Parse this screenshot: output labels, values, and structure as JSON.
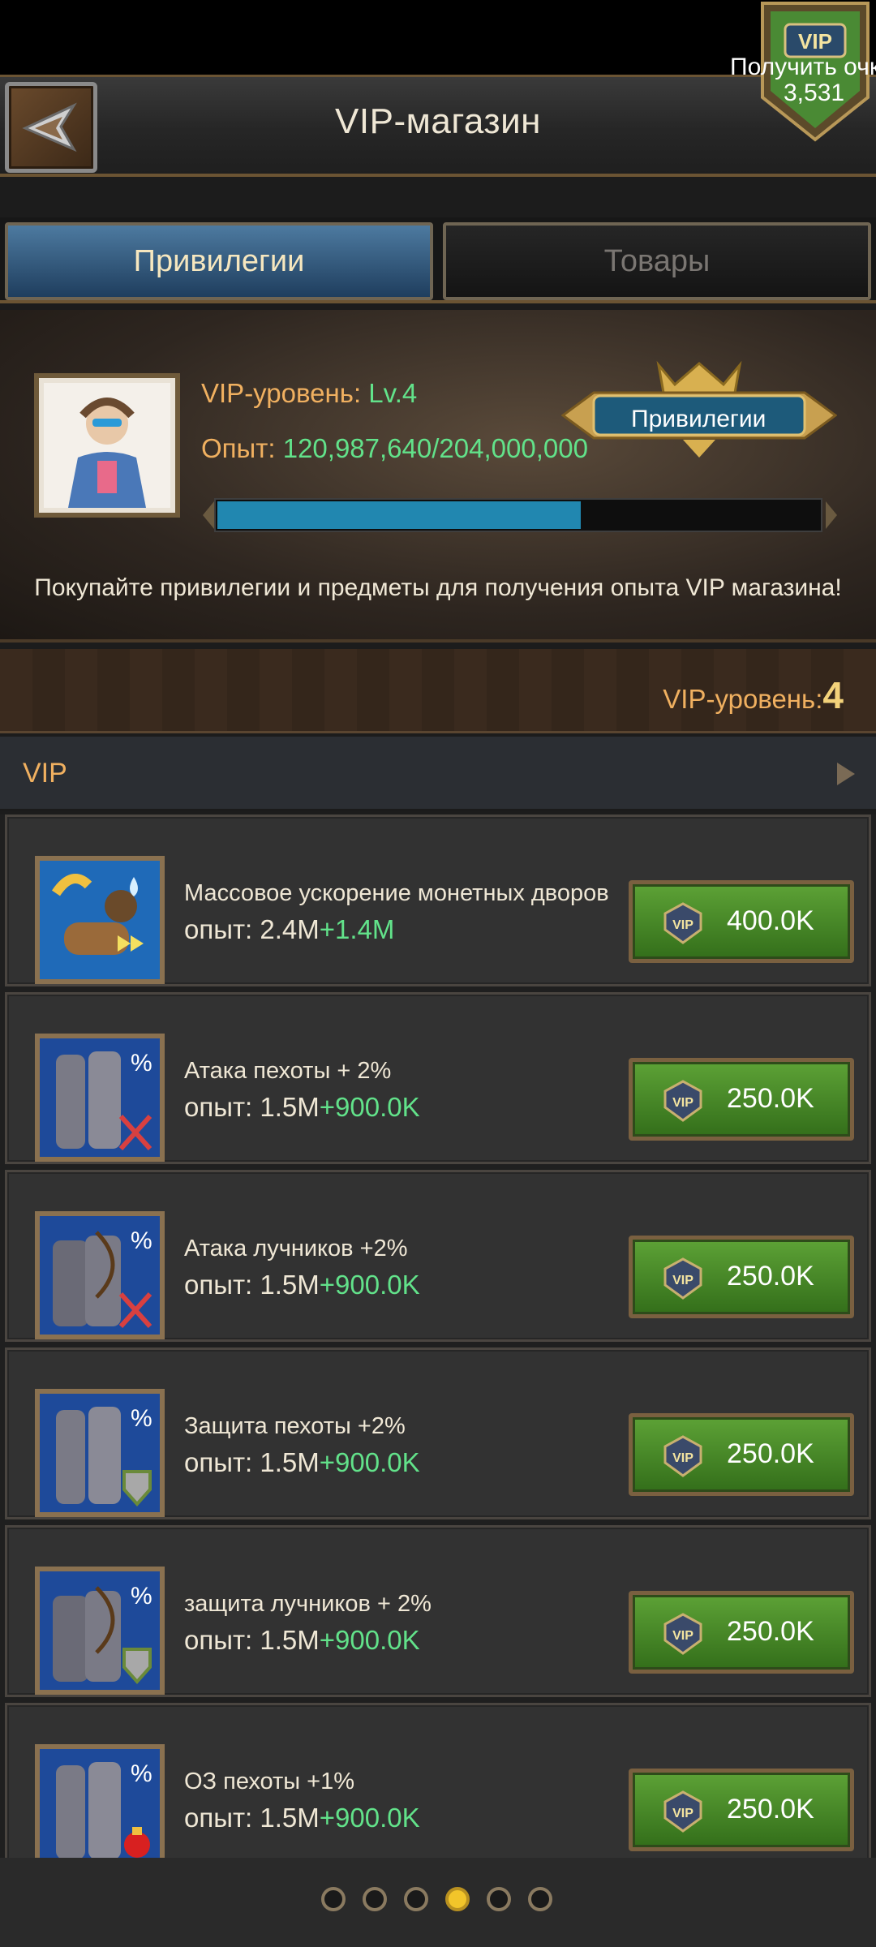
{
  "header": {
    "title": "VIP-магазин",
    "vip_label": "Получить очки",
    "vip_points": "3,531"
  },
  "tabs": [
    {
      "label": "Привилегии",
      "active": true
    },
    {
      "label": "Товары",
      "active": false
    }
  ],
  "vip_info": {
    "level_label": "VIP-уровень:",
    "level_value": "Lv.4",
    "exp_label": "Опыт:",
    "exp_value": "120,987,640/204,000,000",
    "progress": 0.6,
    "privilege_button": "Привилегии",
    "promo_text": "Покупайте привилегии и предметы для получения опыта VIP магазина!"
  },
  "level_bar": {
    "label": "VIP-уровень:",
    "value": "4"
  },
  "section": {
    "title": "VIP"
  },
  "items": [
    {
      "name": "Массовое ускорение монетных дворов",
      "exp_label": "опыт:",
      "exp": "2.4M",
      "bonus": "+1.4M",
      "price": "400.0K",
      "icon": "mint-speedup-icon"
    },
    {
      "name": "Атака пехоты + 2%",
      "exp_label": "опыт:",
      "exp": "1.5M",
      "bonus": "+900.0K",
      "price": "250.0K",
      "icon": "infantry-attack-icon"
    },
    {
      "name": "Атака лучников +2%",
      "exp_label": "опыт:",
      "exp": "1.5M",
      "bonus": "+900.0K",
      "price": "250.0K",
      "icon": "archer-attack-icon"
    },
    {
      "name": "Защита пехоты +2%",
      "exp_label": "опыт:",
      "exp": "1.5M",
      "bonus": "+900.0K",
      "price": "250.0K",
      "icon": "infantry-defense-icon"
    },
    {
      "name": "защита лучников + 2%",
      "exp_label": "опыт:",
      "exp": "1.5M",
      "bonus": "+900.0K",
      "price": "250.0K",
      "icon": "archer-defense-icon"
    },
    {
      "name": "ОЗ пехоты +1%",
      "exp_label": "опыт:",
      "exp": "1.5M",
      "bonus": "+900.0K",
      "price": "250.0K",
      "icon": "infantry-hp-icon"
    }
  ],
  "pager": {
    "total": 6,
    "active": 4
  },
  "colors": {
    "accent_orange": "#f0b060",
    "exp_green": "#62e28a",
    "progress_blue": "#2187b0",
    "buy_green": "#4c8f2a",
    "pager_active": "#f2c52a"
  }
}
